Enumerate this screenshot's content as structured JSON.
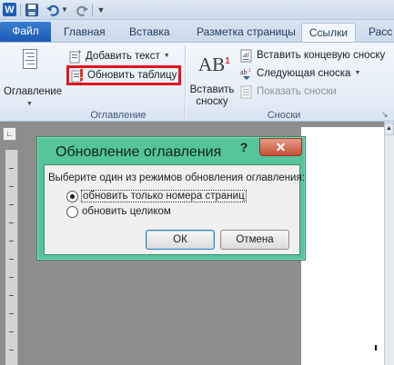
{
  "quick_access": {
    "app_icon_letter": "W",
    "icons": [
      "save-icon",
      "undo-icon",
      "redo-icon",
      "customize-icon"
    ]
  },
  "tabs": {
    "file": "Файл",
    "home": "Главная",
    "insert": "Вставка",
    "layout": "Разметка страницы",
    "references": "Ссылки",
    "mailings": "Расс"
  },
  "ribbon": {
    "toc_group": {
      "toc_button": "Оглавление",
      "add_text": "Добавить текст",
      "update_table": "Обновить таблицу",
      "label": "Оглавление"
    },
    "footnotes_group": {
      "insert_footnote_line1": "Вставить",
      "insert_footnote_line2": "сноску",
      "footnote_icon_text": "AB",
      "footnote_icon_sup": "1",
      "insert_endnote": "Вставить концевую сноску",
      "next_footnote": "Следующая сноска",
      "show_notes": "Показать сноски",
      "label": "Сноски"
    }
  },
  "dialog": {
    "title": "Обновление оглавления",
    "help": "?",
    "close": "✕",
    "prompt": "Выберите один из режимов обновления оглавления:",
    "options": [
      {
        "label": "обновить только номера страниц",
        "selected": true
      },
      {
        "label": "обновить целиком",
        "selected": false
      }
    ],
    "ok": "ОК",
    "cancel": "Отмена"
  },
  "colors": {
    "dialog_frame": "#55c49a",
    "file_tab": "#1c5ab5",
    "highlight": "#e3141d"
  }
}
